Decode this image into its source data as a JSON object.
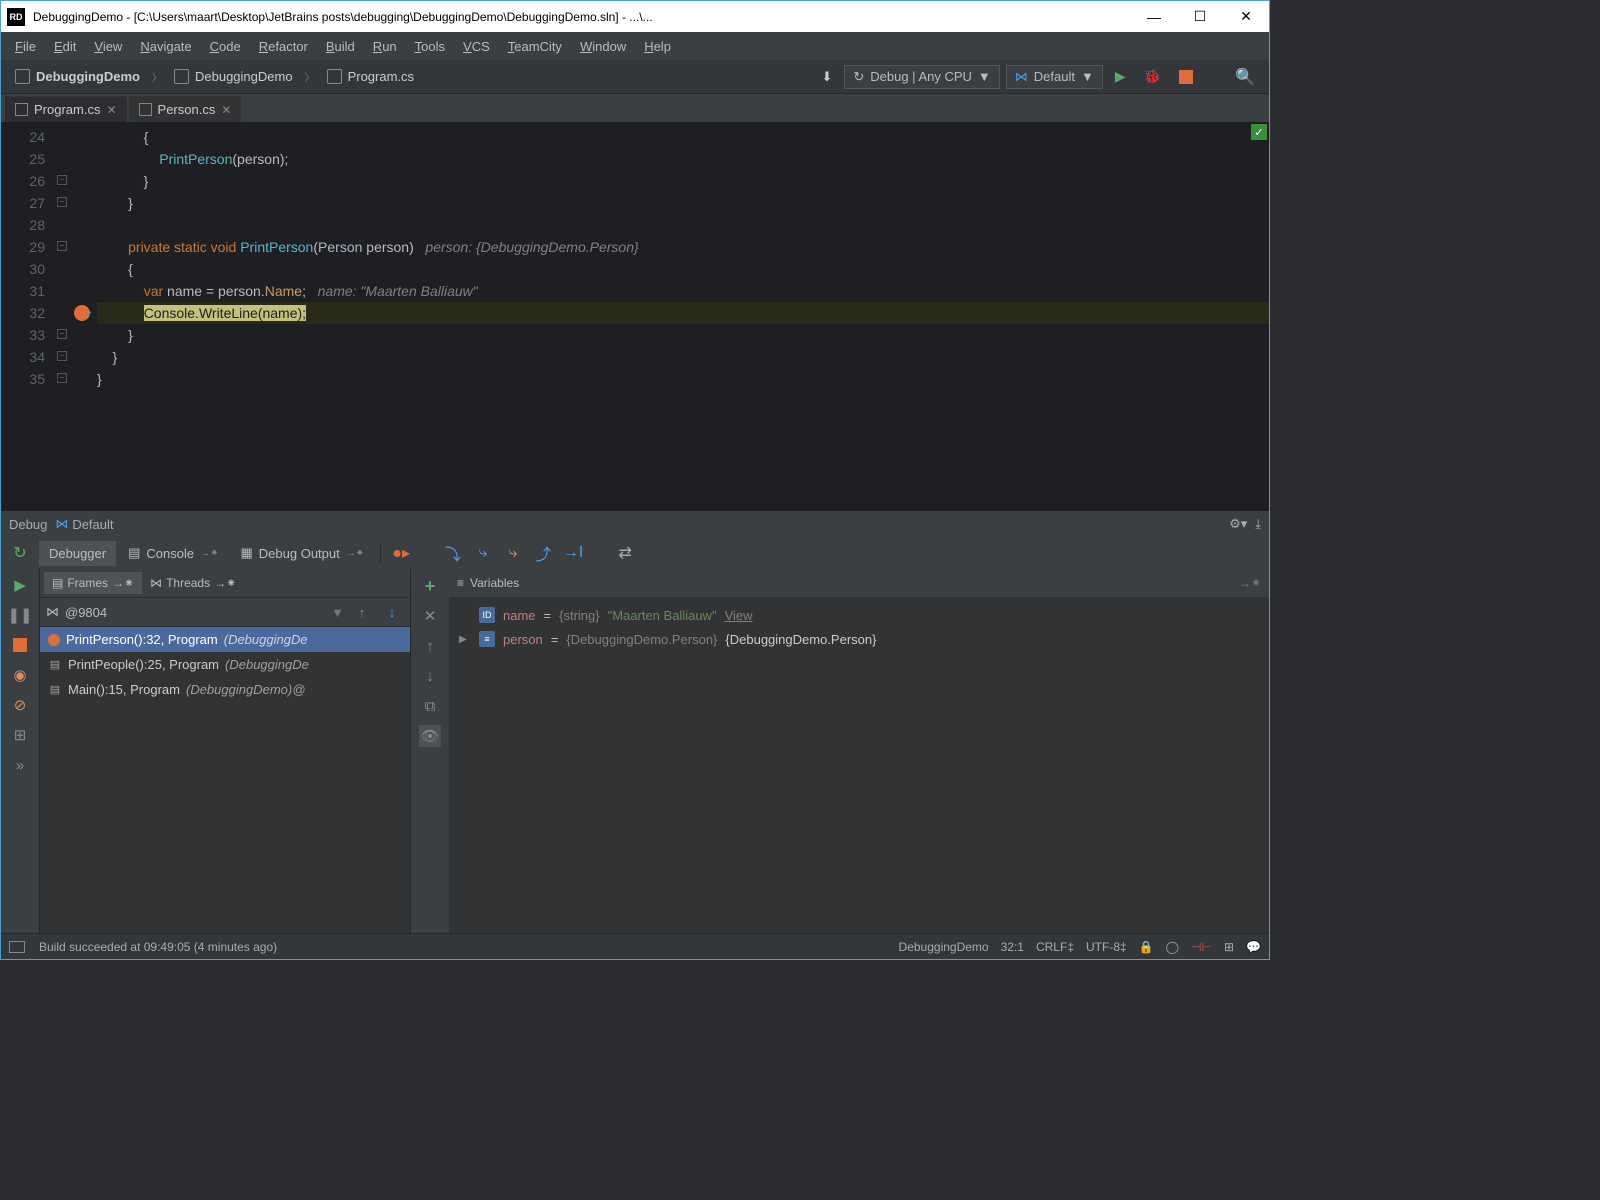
{
  "title": "DebuggingDemo - [C:\\Users\\maart\\Desktop\\JetBrains posts\\debugging\\DebuggingDemo\\DebuggingDemo.sln] - ...\\...",
  "menu": [
    "File",
    "Edit",
    "View",
    "Navigate",
    "Code",
    "Refactor",
    "Build",
    "Run",
    "Tools",
    "VCS",
    "TeamCity",
    "Window",
    "Help"
  ],
  "crumbs": [
    "DebuggingDemo",
    "DebuggingDemo",
    "Program.cs"
  ],
  "config": {
    "run": "Debug | Any CPU",
    "target": "Default"
  },
  "tabs": [
    {
      "label": "Program.cs",
      "active": true
    },
    {
      "label": "Person.cs",
      "active": false
    }
  ],
  "lines": [
    {
      "n": 24,
      "html": "            {"
    },
    {
      "n": 25,
      "html": "                <span class=fn>PrintPerson</span>(person);"
    },
    {
      "n": 26,
      "fold": true,
      "html": "            }"
    },
    {
      "n": 27,
      "fold": true,
      "html": "        }"
    },
    {
      "n": 28,
      "html": ""
    },
    {
      "n": 29,
      "fold": true,
      "html": "        <span class=kw>private</span> <span class=kw>static</span> <span class=kw>void</span> <span class=fn>PrintPerson</span>(<span class=ty>Person</span> person)   <span class=hint>person: {DebuggingDemo.Person}</span>"
    },
    {
      "n": 30,
      "html": "        {"
    },
    {
      "n": 31,
      "html": "            <span class=kw>var</span> name = person.<span class=prop>Name</span>;   <span class=hint>name: \"Maarten Balliauw\"</span>"
    },
    {
      "n": 32,
      "bp": true,
      "hl": true,
      "html": "            <span class=hlspan>Console.WriteLine(name);</span>"
    },
    {
      "n": 33,
      "fold": true,
      "html": "        }"
    },
    {
      "n": 34,
      "fold": true,
      "html": "    }"
    },
    {
      "n": 35,
      "fold": true,
      "html": "}"
    }
  ],
  "debug": {
    "title": "Debug",
    "config": "Default",
    "tabs": [
      "Debugger",
      "Console",
      "Debug Output"
    ],
    "framesTabs": [
      "Frames",
      "Threads"
    ],
    "thread": "@9804",
    "frames": [
      {
        "text": "PrintPerson():32, Program",
        "dim": "(DebuggingDe",
        "bp": true,
        "sel": true
      },
      {
        "text": "PrintPeople():25, Program",
        "dim": "(DebuggingDe",
        "bp": false,
        "sel": false
      },
      {
        "text": "Main():15, Program",
        "dim": "(DebuggingDemo)@",
        "bp": false,
        "sel": false
      }
    ],
    "varsTitle": "Variables",
    "vars": [
      {
        "name": "name",
        "type": "{string}",
        "val": "\"Maarten Balliauw\"",
        "view": "View",
        "exp": false,
        "icon": "ID"
      },
      {
        "name": "person",
        "type": "{DebuggingDemo.Person}",
        "val": "{DebuggingDemo.Person}",
        "exp": true,
        "icon": "≡"
      }
    ]
  },
  "status": {
    "msg": "Build succeeded at 09:49:05 (4 minutes ago)",
    "project": "DebuggingDemo",
    "pos": "32:1",
    "eol": "CRLF",
    "enc": "UTF-8"
  }
}
